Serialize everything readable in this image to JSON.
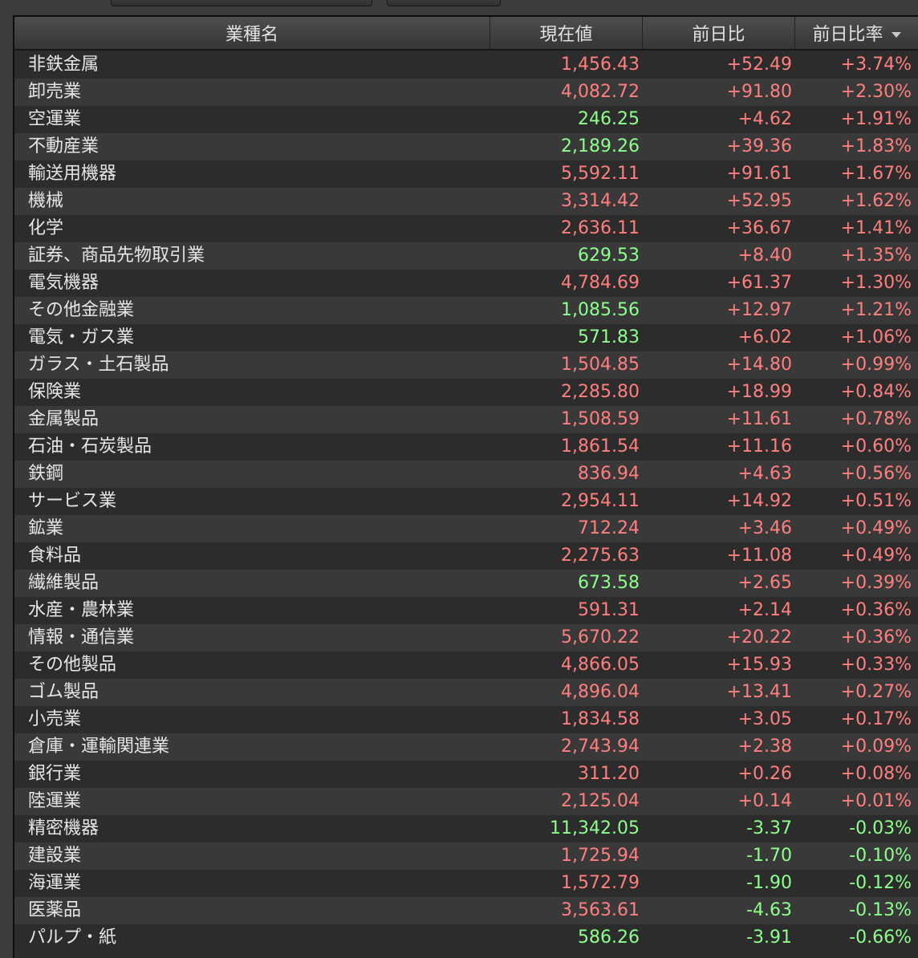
{
  "header": {
    "col_name": "業種名",
    "col_price": "現在値",
    "col_change": "前日比",
    "col_pct": "前日比率"
  },
  "colors": {
    "up": "#ff7f7f",
    "down": "#8cff8c",
    "text": "#e6e6e6"
  },
  "rows": [
    {
      "name": "非鉄金属",
      "price": "1,456.43",
      "price_color": "red",
      "change": "+52.49",
      "pct": "+3.74%"
    },
    {
      "name": "卸売業",
      "price": "4,082.72",
      "price_color": "red",
      "change": "+91.80",
      "pct": "+2.30%"
    },
    {
      "name": "空運業",
      "price": "246.25",
      "price_color": "green",
      "change": "+4.62",
      "pct": "+1.91%"
    },
    {
      "name": "不動産業",
      "price": "2,189.26",
      "price_color": "green",
      "change": "+39.36",
      "pct": "+1.83%"
    },
    {
      "name": "輸送用機器",
      "price": "5,592.11",
      "price_color": "red",
      "change": "+91.61",
      "pct": "+1.67%"
    },
    {
      "name": "機械",
      "price": "3,314.42",
      "price_color": "red",
      "change": "+52.95",
      "pct": "+1.62%"
    },
    {
      "name": "化学",
      "price": "2,636.11",
      "price_color": "red",
      "change": "+36.67",
      "pct": "+1.41%"
    },
    {
      "name": "証券、商品先物取引業",
      "price": "629.53",
      "price_color": "green",
      "change": "+8.40",
      "pct": "+1.35%"
    },
    {
      "name": "電気機器",
      "price": "4,784.69",
      "price_color": "red",
      "change": "+61.37",
      "pct": "+1.30%"
    },
    {
      "name": "その他金融業",
      "price": "1,085.56",
      "price_color": "green",
      "change": "+12.97",
      "pct": "+1.21%"
    },
    {
      "name": "電気・ガス業",
      "price": "571.83",
      "price_color": "green",
      "change": "+6.02",
      "pct": "+1.06%"
    },
    {
      "name": "ガラス・土石製品",
      "price": "1,504.85",
      "price_color": "red",
      "change": "+14.80",
      "pct": "+0.99%"
    },
    {
      "name": "保険業",
      "price": "2,285.80",
      "price_color": "red",
      "change": "+18.99",
      "pct": "+0.84%"
    },
    {
      "name": "金属製品",
      "price": "1,508.59",
      "price_color": "red",
      "change": "+11.61",
      "pct": "+0.78%"
    },
    {
      "name": "石油・石炭製品",
      "price": "1,861.54",
      "price_color": "red",
      "change": "+11.16",
      "pct": "+0.60%"
    },
    {
      "name": "鉄鋼",
      "price": "836.94",
      "price_color": "red",
      "change": "+4.63",
      "pct": "+0.56%"
    },
    {
      "name": "サービス業",
      "price": "2,954.11",
      "price_color": "red",
      "change": "+14.92",
      "pct": "+0.51%"
    },
    {
      "name": "鉱業",
      "price": "712.24",
      "price_color": "red",
      "change": "+3.46",
      "pct": "+0.49%"
    },
    {
      "name": "食料品",
      "price": "2,275.63",
      "price_color": "red",
      "change": "+11.08",
      "pct": "+0.49%"
    },
    {
      "name": "繊維製品",
      "price": "673.58",
      "price_color": "green",
      "change": "+2.65",
      "pct": "+0.39%"
    },
    {
      "name": "水産・農林業",
      "price": "591.31",
      "price_color": "red",
      "change": "+2.14",
      "pct": "+0.36%"
    },
    {
      "name": "情報・通信業",
      "price": "5,670.22",
      "price_color": "red",
      "change": "+20.22",
      "pct": "+0.36%"
    },
    {
      "name": "その他製品",
      "price": "4,866.05",
      "price_color": "red",
      "change": "+15.93",
      "pct": "+0.33%"
    },
    {
      "name": "ゴム製品",
      "price": "4,896.04",
      "price_color": "red",
      "change": "+13.41",
      "pct": "+0.27%"
    },
    {
      "name": "小売業",
      "price": "1,834.58",
      "price_color": "red",
      "change": "+3.05",
      "pct": "+0.17%"
    },
    {
      "name": "倉庫・運輸関連業",
      "price": "2,743.94",
      "price_color": "red",
      "change": "+2.38",
      "pct": "+0.09%"
    },
    {
      "name": "銀行業",
      "price": "311.20",
      "price_color": "red",
      "change": "+0.26",
      "pct": "+0.08%"
    },
    {
      "name": "陸運業",
      "price": "2,125.04",
      "price_color": "red",
      "change": "+0.14",
      "pct": "+0.01%"
    },
    {
      "name": "精密機器",
      "price": "11,342.05",
      "price_color": "green",
      "change": "-3.37",
      "pct": "-0.03%"
    },
    {
      "name": "建設業",
      "price": "1,725.94",
      "price_color": "red",
      "change": "-1.70",
      "pct": "-0.10%"
    },
    {
      "name": "海運業",
      "price": "1,572.79",
      "price_color": "red",
      "change": "-1.90",
      "pct": "-0.12%"
    },
    {
      "name": "医薬品",
      "price": "3,563.61",
      "price_color": "red",
      "change": "-4.63",
      "pct": "-0.13%"
    },
    {
      "name": "パルプ・紙",
      "price": "586.26",
      "price_color": "green",
      "change": "-3.91",
      "pct": "-0.66%"
    }
  ]
}
